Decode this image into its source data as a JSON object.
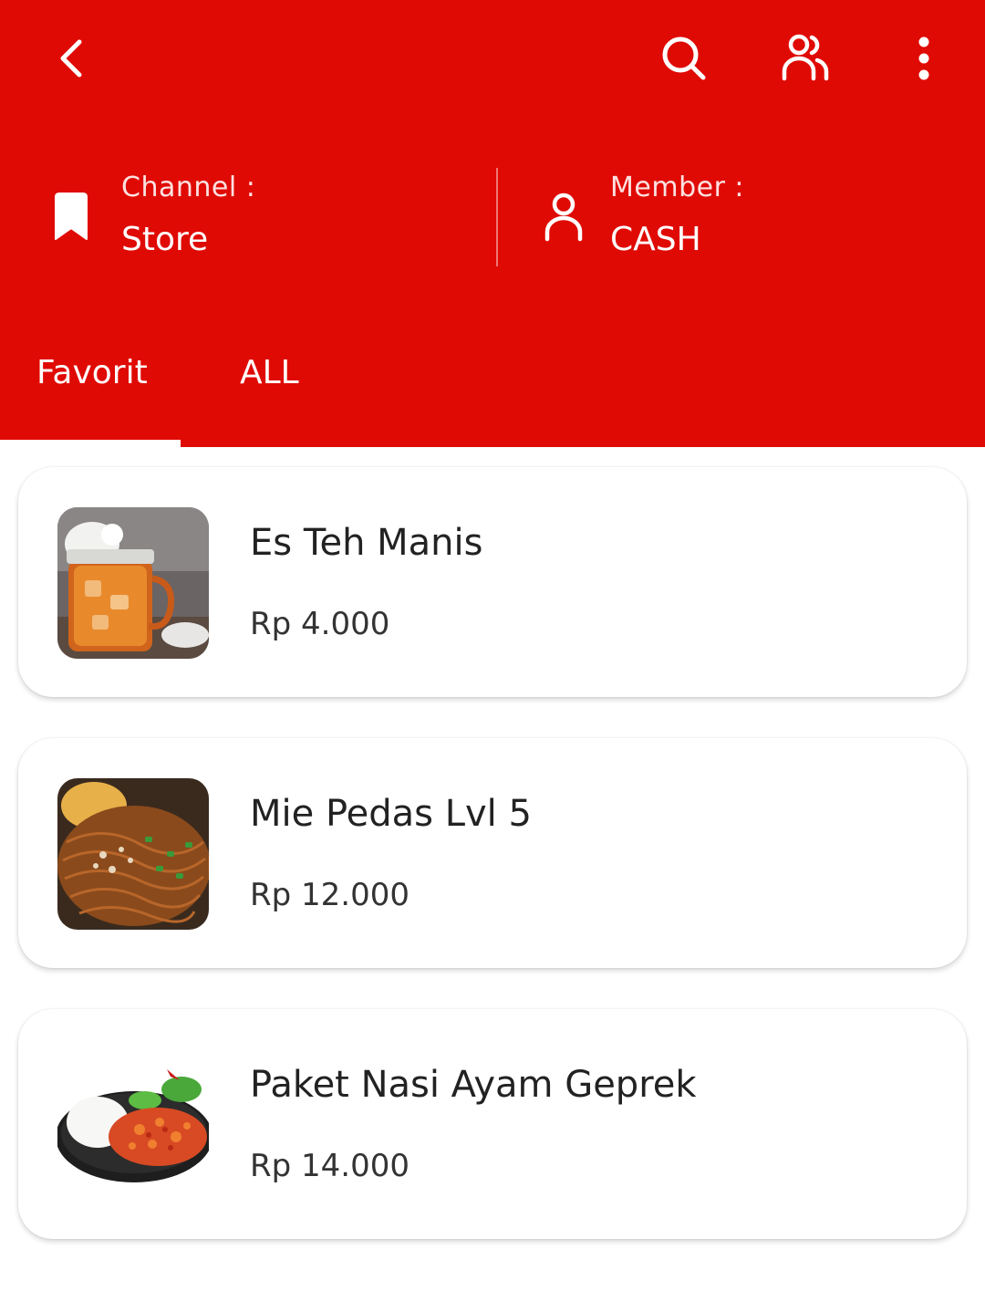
{
  "header": {
    "background_color": "#e00a04",
    "actions": {
      "back_icon": "chevron-left-icon",
      "search_icon": "search-icon",
      "members_icon": "users-icon",
      "more_icon": "more-vertical-icon"
    },
    "channel": {
      "icon": "bookmark-icon",
      "label": "Channel :",
      "value": "Store"
    },
    "member": {
      "icon": "user-icon",
      "label": "Member :",
      "value": "CASH"
    }
  },
  "tabs": [
    {
      "label": "Favorit",
      "active": true
    },
    {
      "label": "ALL",
      "active": false
    }
  ],
  "products": [
    {
      "name": "Es Teh Manis",
      "price": "Rp 4.000",
      "image": "iced-tea-image"
    },
    {
      "name": "Mie Pedas Lvl 5",
      "price": "Rp 12.000",
      "image": "spicy-noodles-image"
    },
    {
      "name": "Paket Nasi Ayam Geprek",
      "price": "Rp 14.000",
      "image": "geprek-chicken-rice-image"
    }
  ]
}
